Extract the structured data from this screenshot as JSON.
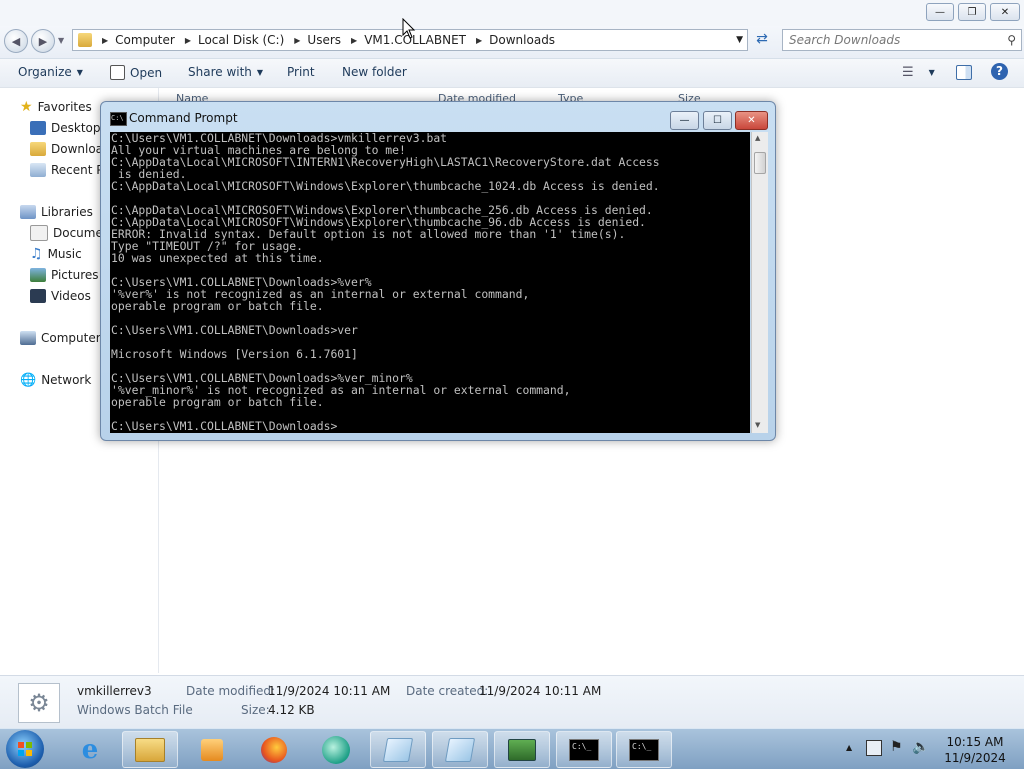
{
  "explorer": {
    "breadcrumb": [
      "Computer",
      "Local Disk (C:)",
      "Users",
      "VM1.COLLABNET",
      "Downloads"
    ],
    "search_placeholder": "Search Downloads",
    "toolbar": {
      "organize": "Organize",
      "open": "Open",
      "share_with": "Share with",
      "print": "Print",
      "new_folder": "New folder"
    },
    "columns": {
      "name": "Name",
      "date_modified": "Date modified",
      "type": "Type",
      "size": "Size"
    },
    "nav": {
      "favorites": "Favorites",
      "desktop": "Desktop",
      "downloads": "Downloads",
      "recent": "Recent Places",
      "libraries": "Libraries",
      "documents": "Documents",
      "music": "Music",
      "pictures": "Pictures",
      "videos": "Videos",
      "computer": "Computer",
      "network": "Network"
    },
    "details": {
      "file_name": "vmkillerrev3",
      "file_type": "Windows Batch File",
      "date_modified_label": "Date modified:",
      "date_modified": "11/9/2024 10:11 AM",
      "date_created_label": "Date created:",
      "date_created": "11/9/2024 10:11 AM",
      "size_label": "Size:",
      "size": "4.12 KB"
    }
  },
  "cmd": {
    "title": "Command Prompt",
    "text": "C:\\Users\\VM1.COLLABNET\\Downloads>vmkillerrev3.bat\nAll your virtual machines are belong to me!\nC:\\AppData\\Local\\MICROSOFT\\INTERN1\\RecoveryHigh\\LASTAC1\\RecoveryStore.dat Access\n is denied.\nC:\\AppData\\Local\\MICROSOFT\\Windows\\Explorer\\thumbcache_1024.db Access is denied.\n\nC:\\AppData\\Local\\MICROSOFT\\Windows\\Explorer\\thumbcache_256.db Access is denied.\nC:\\AppData\\Local\\MICROSOFT\\Windows\\Explorer\\thumbcache_96.db Access is denied.\nERROR: Invalid syntax. Default option is not allowed more than '1' time(s).\nType \"TIMEOUT /?\" for usage.\n10 was unexpected at this time.\n\nC:\\Users\\VM1.COLLABNET\\Downloads>%ver%\n'%ver%' is not recognized as an internal or external command,\noperable program or batch file.\n\nC:\\Users\\VM1.COLLABNET\\Downloads>ver\n\nMicrosoft Windows [Version 6.1.7601]\n\nC:\\Users\\VM1.COLLABNET\\Downloads>%ver_minor%\n'%ver_minor%' is not recognized as an internal or external command,\noperable program or batch file.\n\nC:\\Users\\VM1.COLLABNET\\Downloads>"
  },
  "taskbar": {
    "clock_time": "10:15 AM",
    "clock_date": "11/9/2024",
    "cmd_icon_label": "C:\\_"
  },
  "colors": {
    "cmd_bg": "#000000",
    "cmd_fg": "#c0c0c0",
    "close_red": "#c9473b"
  }
}
